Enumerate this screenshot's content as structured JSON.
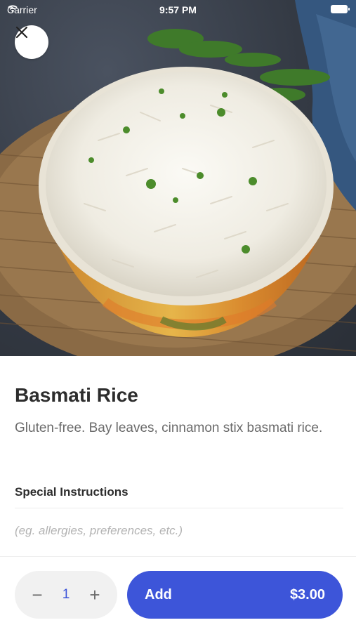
{
  "status_bar": {
    "carrier": "Carrier",
    "time": "9:57 PM",
    "icons": [
      "wifi-icon",
      "battery-icon"
    ]
  },
  "header": {
    "close_icon": "close-icon"
  },
  "item": {
    "name": "Basmati Rice",
    "description": "Gluten-free. Bay leaves, cinnamon stix basmati rice.",
    "image": "bowl of basmati rice on burlap"
  },
  "special_instructions": {
    "label": "Special Instructions",
    "value": "",
    "placeholder": "(eg. allergies, preferences, etc.)"
  },
  "footer": {
    "quantity": "1",
    "decrement_symbol": "−",
    "increment_symbol": "+",
    "add_label": "Add",
    "price": "$3.00"
  },
  "colors": {
    "accent": "#3d55d9",
    "stepper_bg": "#f1f1f1",
    "title_text": "#2d2d2d",
    "body_text": "#6a6a6a",
    "placeholder_text": "#b3b3b3"
  }
}
